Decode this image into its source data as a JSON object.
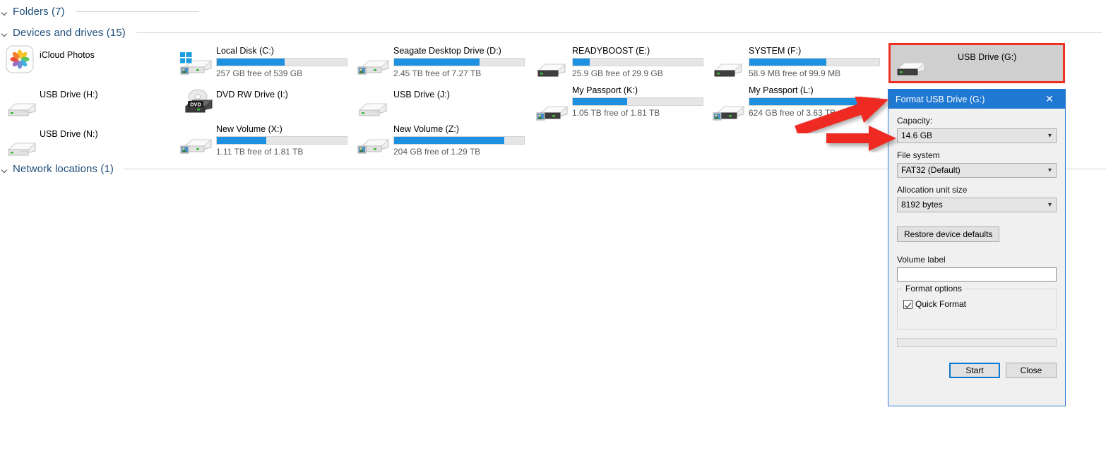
{
  "sections": [
    {
      "label": "Folders (7)",
      "rule_width": 175
    },
    {
      "label": "Devices and drives (15)",
      "rule_width": 1368
    },
    {
      "label": "Network locations (1)",
      "rule_width": 1390
    }
  ],
  "sidebar": {
    "items": [
      {
        "name": "iCloud Photos",
        "icon": "icloud-photos-icon"
      },
      {
        "name": "USB Drive (H:)",
        "icon": "usb-drive-icon"
      },
      {
        "name": "USB Drive (N:)",
        "icon": "usb-drive-icon"
      }
    ]
  },
  "drives": [
    {
      "name": "Local Disk (C:)",
      "icon": "windows-drive-icon",
      "free": "257 GB free of 539 GB",
      "fill_pct": 52,
      "has_bar": true
    },
    {
      "name": "DVD RW Drive (I:)",
      "icon": "dvd-drive-icon",
      "free": "",
      "fill_pct": 0,
      "has_bar": false
    },
    {
      "name": "New Volume (X:)",
      "icon": "shared-drive-icon",
      "free": "1.11 TB free of 1.81 TB",
      "fill_pct": 38,
      "has_bar": true
    },
    {
      "name": "Seagate Desktop Drive (D:)",
      "icon": "shared-drive-icon",
      "free": "2.45 TB free of 7.27 TB",
      "fill_pct": 66,
      "has_bar": true
    },
    {
      "name": "USB Drive (J:)",
      "icon": "usb-drive-icon",
      "free": "",
      "fill_pct": 0,
      "has_bar": false
    },
    {
      "name": "New Volume (Z:)",
      "icon": "shared-drive-icon",
      "free": "204 GB free of 1.29 TB",
      "fill_pct": 85,
      "has_bar": true
    },
    {
      "name": "READYBOOST (E:)",
      "icon": "usb-drive-icon",
      "free": "25.9 GB free of 29.9 GB",
      "fill_pct": 13,
      "has_bar": true
    },
    {
      "name": "My Passport (K:)",
      "icon": "shared-drive-icon",
      "free": "1.05 TB free of 1.81 TB",
      "fill_pct": 42,
      "has_bar": true
    },
    {
      "name": "SYSTEM (F:)",
      "icon": "usb-drive-icon",
      "free": "58.9 MB free of 99.9 MB",
      "fill_pct": 59,
      "has_bar": true
    },
    {
      "name": "My Passport (L:)",
      "icon": "shared-drive-icon",
      "free": "624 GB free of 3.63 TB",
      "fill_pct": 84,
      "has_bar": true
    }
  ],
  "selected_drive": {
    "name": "USB Drive (G:)",
    "icon": "usb-drive-icon",
    "highlight_color": "#ef3124",
    "selection_color": "#cfcfcf"
  },
  "dialog": {
    "title": "Format USB Drive (G:)",
    "title_bar_color": "#1f78d1",
    "close_icon": "close-icon",
    "capacity_label": "Capacity:",
    "capacity_value": "14.6 GB",
    "file_system_label": "File system",
    "file_system_value": "FAT32 (Default)",
    "allocation_label": "Allocation unit size",
    "allocation_value": "8192 bytes",
    "restore_defaults_label": "Restore device defaults",
    "volume_label_label": "Volume label",
    "volume_label_value": "",
    "format_options_label": "Format options",
    "quick_format_label": "Quick Format",
    "quick_format_checked": true,
    "start_label": "Start",
    "close_label": "Close"
  },
  "annotations": {
    "arrow_color": "#ee2b20",
    "arrows": [
      {
        "name": "arrow-to-title-bar",
        "target": "Format USB Drive (G:) title bar"
      },
      {
        "name": "arrow-to-capacity",
        "target": "Capacity dropdown"
      }
    ]
  }
}
